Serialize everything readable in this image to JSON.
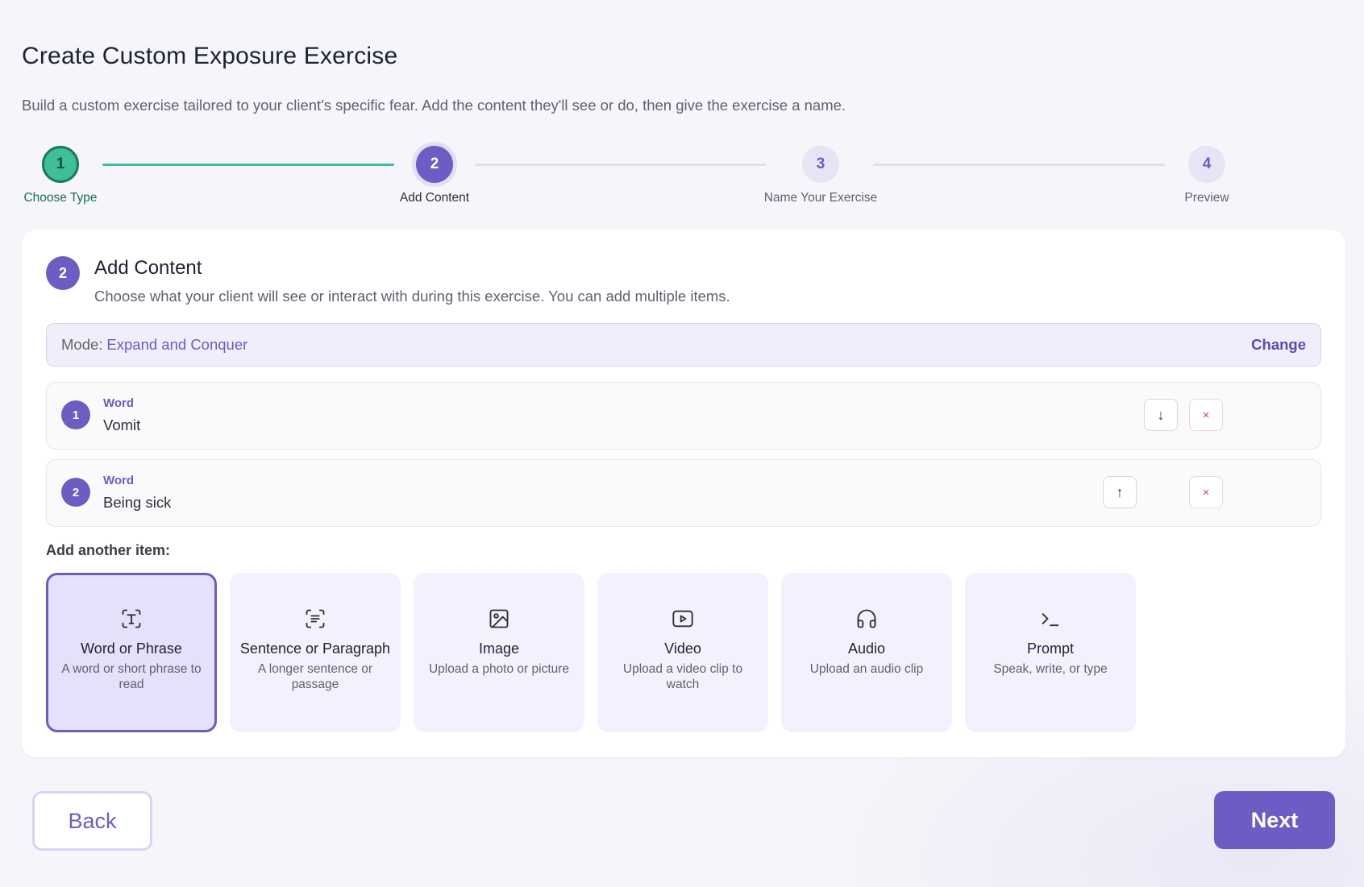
{
  "page": {
    "title": "Create Custom Exposure Exercise",
    "subtitle": "Build a custom exercise tailored to your client's specific fear. Add the content they'll see or do, then give the exercise a name."
  },
  "stepper": {
    "steps": [
      {
        "number": "1",
        "label": "Choose Type",
        "state": "done"
      },
      {
        "number": "2",
        "label": "Add Content",
        "state": "active"
      },
      {
        "number": "3",
        "label": "Name Your Exercise",
        "state": "pending"
      },
      {
        "number": "4",
        "label": "Preview",
        "state": "pending"
      }
    ]
  },
  "card": {
    "number": "2",
    "title": "Add Content",
    "description": "Choose what your client will see or interact with during this exercise. You can add multiple items.",
    "mode": {
      "label": "Mode:",
      "value": "Expand and Conquer",
      "change_label": "Change"
    },
    "items": [
      {
        "number": "1",
        "type": "Word",
        "value": "Vomit",
        "move_icon": "↓",
        "remove_icon": "×"
      },
      {
        "number": "2",
        "type": "Word",
        "value": "Being sick",
        "move_icon": "↑",
        "remove_icon": "×"
      }
    ],
    "add_label": "Add another item:",
    "tiles": [
      {
        "icon": "text-scan-icon",
        "title": "Word or Phrase",
        "subtitle": "A word or short phrase to read",
        "selected": true
      },
      {
        "icon": "paragraph-scan-icon",
        "title": "Sentence or Paragraph",
        "subtitle": "A longer sentence or passage",
        "selected": false
      },
      {
        "icon": "image-icon",
        "title": "Image",
        "subtitle": "Upload a photo or picture",
        "selected": false
      },
      {
        "icon": "video-icon",
        "title": "Video",
        "subtitle": "Upload a video clip to watch",
        "selected": false
      },
      {
        "icon": "headphones-icon",
        "title": "Audio",
        "subtitle": "Upload an audio clip",
        "selected": false
      },
      {
        "icon": "terminal-prompt-icon",
        "title": "Prompt",
        "subtitle": "Speak, write, or type",
        "selected": false
      }
    ]
  },
  "footer": {
    "back_label": "Back",
    "next_label": "Next"
  },
  "colors": {
    "accent": "#6f5bc4",
    "done": "#3fbf98",
    "background": "#f5f5fa"
  }
}
